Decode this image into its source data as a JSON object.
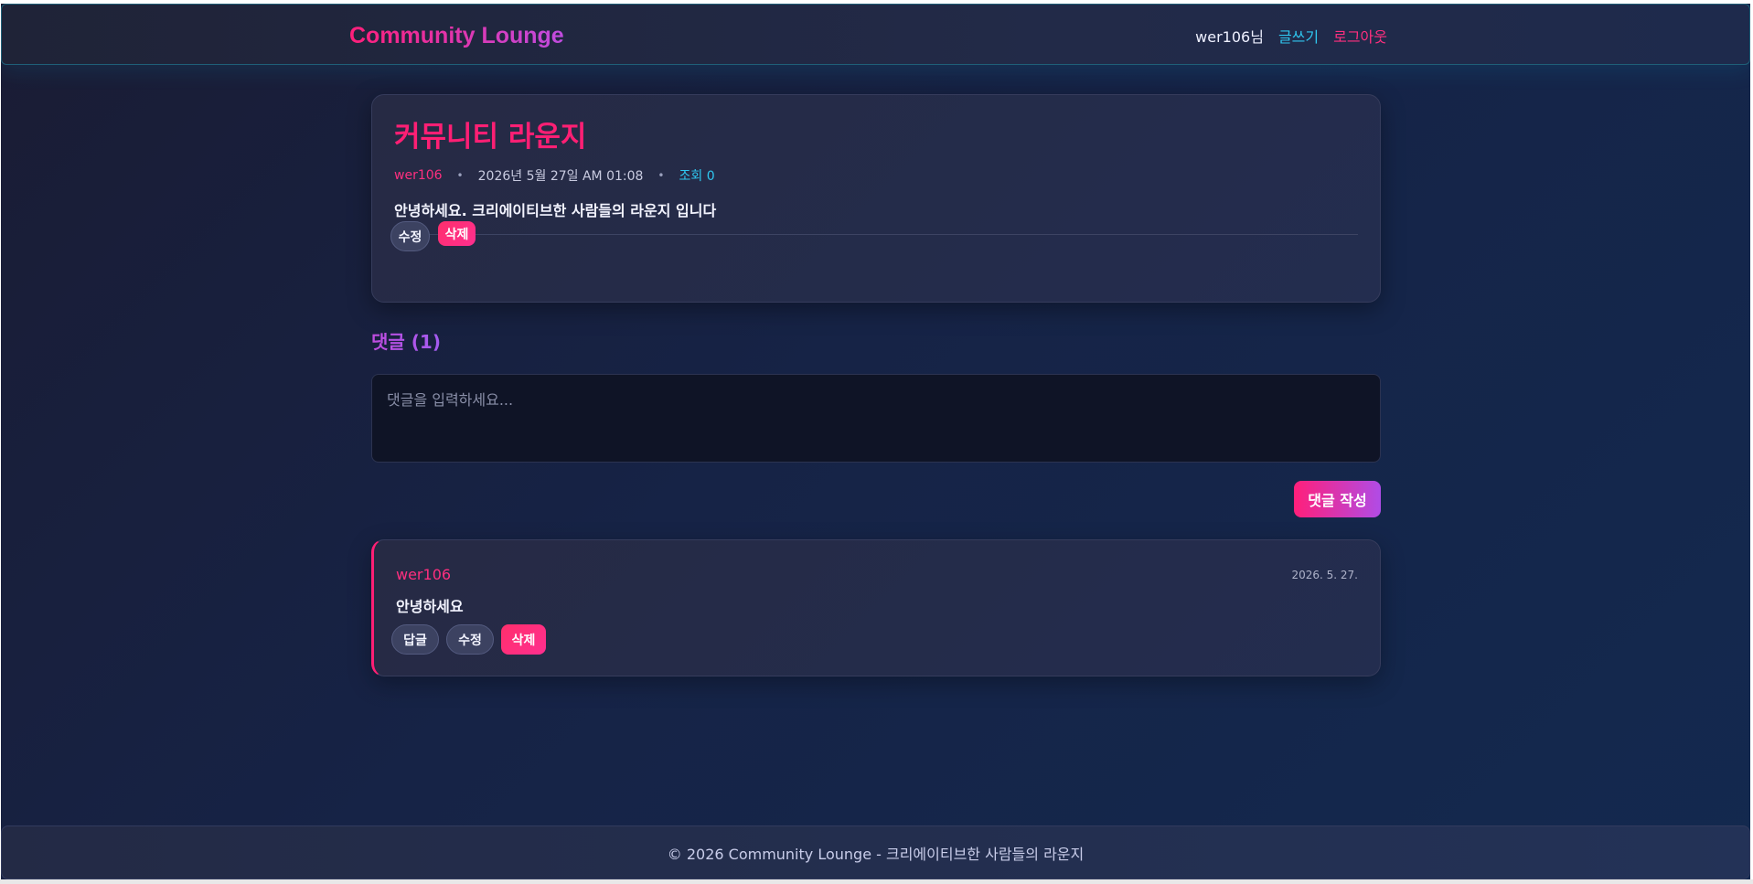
{
  "header": {
    "brand": "Community Lounge",
    "user": "wer106님",
    "write_label": "글쓰기",
    "logout_label": "로그아웃"
  },
  "post": {
    "title": "커뮤니티 라운지",
    "author": "wer106",
    "date": "2026년 5월 27일 AM 01:08",
    "views": "조회 0",
    "body": "안녕하세요. 크리에이티브한 사람들의 라운지 입니다",
    "edit_label": "수정",
    "delete_label": "삭제"
  },
  "comments": {
    "heading": "댓글 (1)",
    "input_placeholder": "댓글을 입력하세요...",
    "submit_label": "댓글 작성",
    "items": [
      {
        "author": "wer106",
        "date": "2026. 5. 27.",
        "body": "안녕하세요",
        "reply_label": "답글",
        "edit_label": "수정",
        "delete_label": "삭제"
      }
    ]
  },
  "footer": {
    "text": "© 2026 Community Lounge - 크리에이티브한 사람들의 라운지"
  },
  "colors": {
    "accent_pink": "#ff1f74",
    "accent_cyan": "#2fc7f0",
    "accent_purple": "#c04ce0",
    "background": "#162346"
  }
}
